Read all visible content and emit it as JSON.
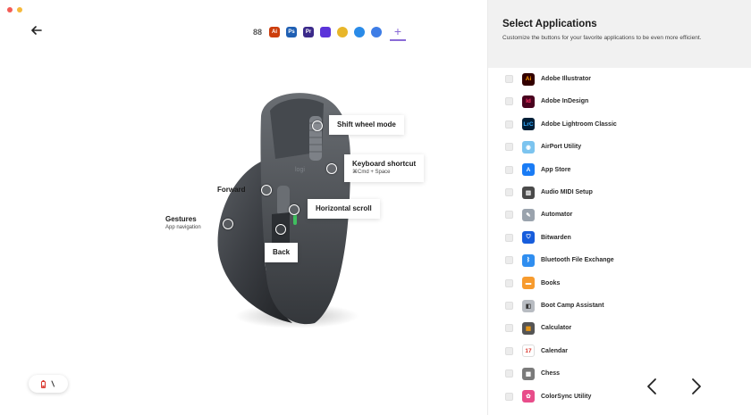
{
  "window": {
    "traffic_lights": [
      "#f35c55",
      "#f6b93b"
    ]
  },
  "toolbar": {
    "back_icon": "arrow-left-icon",
    "app_tabs": [
      {
        "name": "all-applications",
        "icon": "grid-icon",
        "color": "transparent",
        "glyph": "88"
      },
      {
        "name": "adobe-illustrator",
        "icon": "illustrator-icon",
        "color": "#cc3d0b",
        "glyph": "Ai"
      },
      {
        "name": "adobe-photoshop",
        "icon": "photoshop-icon",
        "color": "#1f5fb3",
        "glyph": "Ps"
      },
      {
        "name": "adobe-premiere",
        "icon": "premiere-icon",
        "color": "#3b2a8a",
        "glyph": "Pr"
      },
      {
        "name": "app-5",
        "icon": "app-icon",
        "color": "#5b34d9",
        "glyph": ""
      },
      {
        "name": "google-chrome",
        "icon": "chrome-icon",
        "color": "#e8b62a",
        "glyph": ""
      },
      {
        "name": "safari",
        "icon": "safari-icon",
        "color": "#2a8be8",
        "glyph": ""
      },
      {
        "name": "app-8",
        "icon": "app-icon",
        "color": "#3e7de6",
        "glyph": ""
      }
    ],
    "add_label": "+"
  },
  "mouse": {
    "callouts": {
      "shift_wheel": {
        "label": "Shift wheel mode"
      },
      "keyboard_shortcut": {
        "label": "Keyboard shortcut",
        "sub": "⌘Cmd + Space"
      },
      "forward": {
        "label": "Forward"
      },
      "horizontal_scroll": {
        "label": "Horizontal scroll"
      },
      "gestures": {
        "label": "Gestures",
        "sub": "App navigation"
      },
      "back": {
        "label": "Back"
      }
    }
  },
  "status": {
    "battery_icon": "battery-icon",
    "connection_icon": "connection-icon"
  },
  "panel": {
    "title": "Select Applications",
    "description": "Customize the buttons for your favorite applications to be even more efficient.",
    "apps": [
      {
        "name": "Adobe Illustrator",
        "icon": "illustrator-icon",
        "color": "#330000",
        "fg": "#ff9a00",
        "glyph": "Ai"
      },
      {
        "name": "Adobe InDesign",
        "icon": "indesign-icon",
        "color": "#49021f",
        "fg": "#ff3366",
        "glyph": "Id"
      },
      {
        "name": "Adobe Lightroom Classic",
        "icon": "lightroom-icon",
        "color": "#001e36",
        "fg": "#31a8ff",
        "glyph": "LrC"
      },
      {
        "name": "AirPort Utility",
        "icon": "airport-icon",
        "color": "#7cc4ef",
        "fg": "#ffffff",
        "glyph": "◉"
      },
      {
        "name": "App Store",
        "icon": "app-store-icon",
        "color": "#1a7cf5",
        "fg": "#ffffff",
        "glyph": "A"
      },
      {
        "name": "Audio MIDI Setup",
        "icon": "midi-icon",
        "color": "#4a4a4a",
        "fg": "#ffffff",
        "glyph": "▥"
      },
      {
        "name": "Automator",
        "icon": "automator-icon",
        "color": "#9aa3ad",
        "fg": "#ffffff",
        "glyph": "✎"
      },
      {
        "name": "Bitwarden",
        "icon": "bitwarden-icon",
        "color": "#175ddc",
        "fg": "#ffffff",
        "glyph": "⛉"
      },
      {
        "name": "Bluetooth File Exchange",
        "icon": "bluetooth-icon",
        "color": "#2f8ef0",
        "fg": "#ffffff",
        "glyph": "ᛒ"
      },
      {
        "name": "Books",
        "icon": "books-icon",
        "color": "#f79b2e",
        "fg": "#ffffff",
        "glyph": "▬"
      },
      {
        "name": "Boot Camp Assistant",
        "icon": "boot-camp-icon",
        "color": "#b8bcc2",
        "fg": "#333333",
        "glyph": "◧"
      },
      {
        "name": "Calculator",
        "icon": "calculator-icon",
        "color": "#555555",
        "fg": "#f39c12",
        "glyph": "▦"
      },
      {
        "name": "Calendar",
        "icon": "calendar-icon",
        "color": "#ffffff",
        "fg": "#d9342b",
        "glyph": "17"
      },
      {
        "name": "Chess",
        "icon": "chess-icon",
        "color": "#7a7a7a",
        "fg": "#ffffff",
        "glyph": "▩"
      },
      {
        "name": "ColorSync Utility",
        "icon": "colorsync-icon",
        "color": "#e84d8a",
        "fg": "#ffffff",
        "glyph": "✿"
      }
    ]
  },
  "pager": {
    "prev_icon": "chevron-left-icon",
    "next_icon": "chevron-right-icon"
  }
}
